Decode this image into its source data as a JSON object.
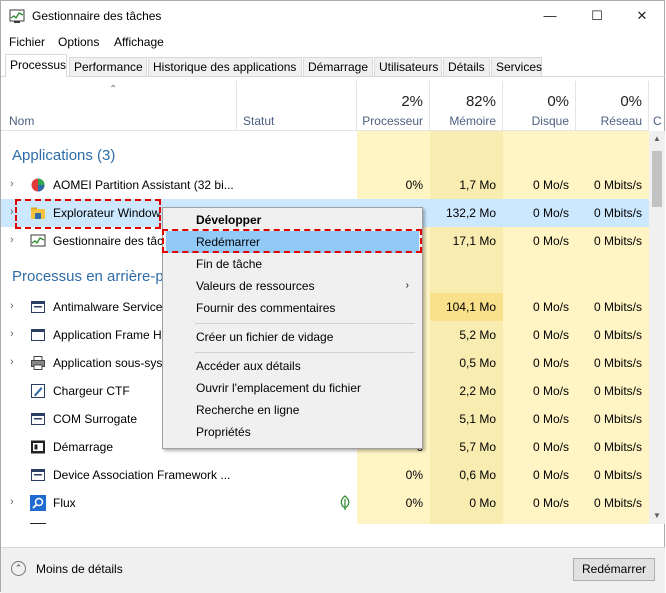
{
  "window": {
    "title": "Gestionnaire des tâches",
    "minimize": "—",
    "maximize": "☐",
    "close": "✕"
  },
  "menu": [
    "Fichier",
    "Options",
    "Affichage"
  ],
  "tabs": [
    "Processus",
    "Performance",
    "Historique des applications",
    "Démarrage",
    "Utilisateurs",
    "Détails",
    "Services"
  ],
  "columns": {
    "name": "Nom",
    "status": "Statut",
    "cpu": {
      "pct": "2%",
      "label": "Processeur"
    },
    "memory": {
      "pct": "82%",
      "label": "Mémoire"
    },
    "disk": {
      "pct": "0%",
      "label": "Disque"
    },
    "network": {
      "pct": "0%",
      "label": "Réseau"
    },
    "more": "C"
  },
  "groups": {
    "apps": "Applications (3)",
    "background": "Processus en arrière-p"
  },
  "apps": [
    {
      "name": "AOMEI Partition Assistant (32 bi...",
      "cpu": "0%",
      "mem": "1,7 Mo",
      "disk": "0 Mo/s",
      "net": "0 Mbits/s",
      "icon": "partition-icon"
    },
    {
      "name": "Explorateur Window",
      "cpu": "6",
      "mem": "132,2 Mo",
      "disk": "0 Mo/s",
      "net": "0 Mbits/s",
      "icon": "folder-icon"
    },
    {
      "name": "Gestionnaire des tâc",
      "cpu": "",
      "mem": "17,1 Mo",
      "disk": "0 Mo/s",
      "net": "0 Mbits/s",
      "icon": "task-manager-icon"
    }
  ],
  "background": [
    {
      "name": "Antimalware Service",
      "cpu": "6",
      "mem": "104,1 Mo",
      "disk": "0 Mo/s",
      "net": "0 Mbits/s",
      "icon": "service-icon"
    },
    {
      "name": "Application Frame H",
      "cpu": "6",
      "mem": "5,2 Mo",
      "disk": "0 Mo/s",
      "net": "0 Mbits/s",
      "icon": "app-frame-icon"
    },
    {
      "name": "Application sous-sys",
      "cpu": "6",
      "mem": "0,5 Mo",
      "disk": "0 Mo/s",
      "net": "0 Mbits/s",
      "icon": "printer-icon"
    },
    {
      "name": "Chargeur CTF",
      "cpu": "6",
      "mem": "2,2 Mo",
      "disk": "0 Mo/s",
      "net": "0 Mbits/s",
      "icon": "ctf-icon"
    },
    {
      "name": "COM Surrogate",
      "cpu": "6",
      "mem": "5,1 Mo",
      "disk": "0 Mo/s",
      "net": "0 Mbits/s",
      "icon": "service-icon"
    },
    {
      "name": "Démarrage",
      "cpu": "6",
      "mem": "5,7 Mo",
      "disk": "0 Mo/s",
      "net": "0 Mbits/s",
      "icon": "startup-icon"
    },
    {
      "name": "Device Association Framework ...",
      "cpu": "0%",
      "mem": "0,6 Mo",
      "disk": "0 Mo/s",
      "net": "0 Mbits/s",
      "icon": "service-icon"
    },
    {
      "name": "Flux",
      "cpu": "0%",
      "mem": "0 Mo",
      "disk": "0 Mo/s",
      "net": "0 Mbits/s",
      "icon": "search-icon"
    }
  ],
  "context_menu": [
    {
      "label": "Développer",
      "bold": true
    },
    {
      "label": "Redémarrer",
      "selected": true
    },
    {
      "label": "Fin de tâche"
    },
    {
      "label": "Valeurs de ressources",
      "submenu": "›"
    },
    {
      "label": "Fournir des commentaires"
    },
    {
      "label": "Créer un fichier de vidage"
    },
    {
      "label": "Accéder aux détails"
    },
    {
      "label": "Ouvrir l'emplacement du fichier"
    },
    {
      "label": "Recherche en ligne"
    },
    {
      "label": "Propriétés"
    }
  ],
  "footer": {
    "less_details": "Moins de détails",
    "restart_button": "Redémarrer"
  },
  "colors": {
    "accent_blue": "#2f6ca8",
    "heat_light": "#fff4c4",
    "heat_dark": "#f9e79f",
    "highlight_red": "#e00000",
    "selection": "#91c9f7"
  }
}
